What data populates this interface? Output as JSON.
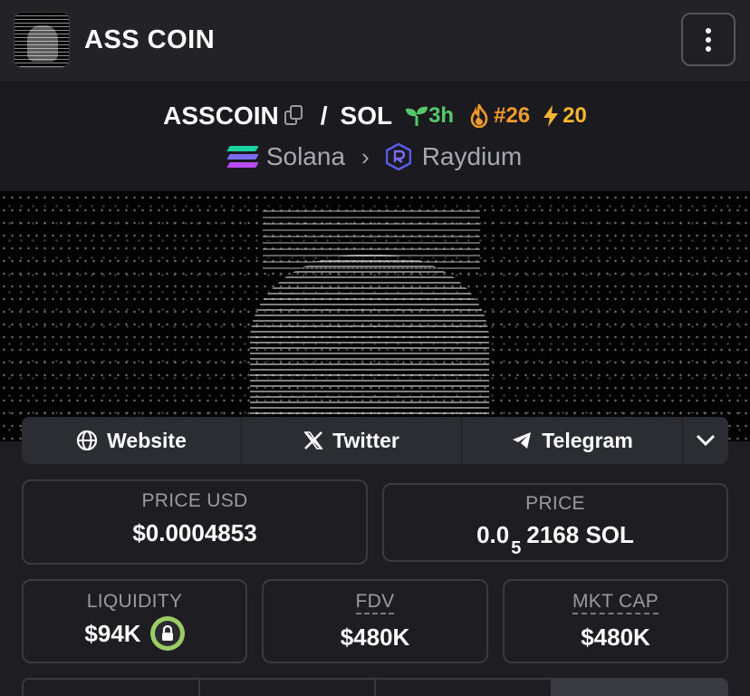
{
  "header": {
    "title": "ASS COIN",
    "menu_icon": "kebab-vertical-icon"
  },
  "pair": {
    "base": "ASSCOIN",
    "separator": "/",
    "quote": "SOL",
    "age": "3h",
    "rank": "#26",
    "boosts": "20",
    "colors": {
      "age": "#55c86a",
      "rank": "#f29a2e",
      "boosts": "#f5b52e"
    }
  },
  "chain": {
    "network": "Solana",
    "dex": "Raydium"
  },
  "socials": {
    "website": "Website",
    "twitter": "Twitter",
    "telegram": "Telegram"
  },
  "stats": {
    "price_usd_label": "PRICE USD",
    "price_usd": "$0.0004853",
    "price_label": "PRICE",
    "price_prefix": "0.0",
    "price_sub": "5",
    "price_suffix": "2168 SOL",
    "liquidity_label": "LIQUIDITY",
    "liquidity": "$94K",
    "fdv_label": "FDV",
    "fdv": "$480K",
    "mcap_label": "MKT CAP",
    "mcap": "$480K"
  }
}
